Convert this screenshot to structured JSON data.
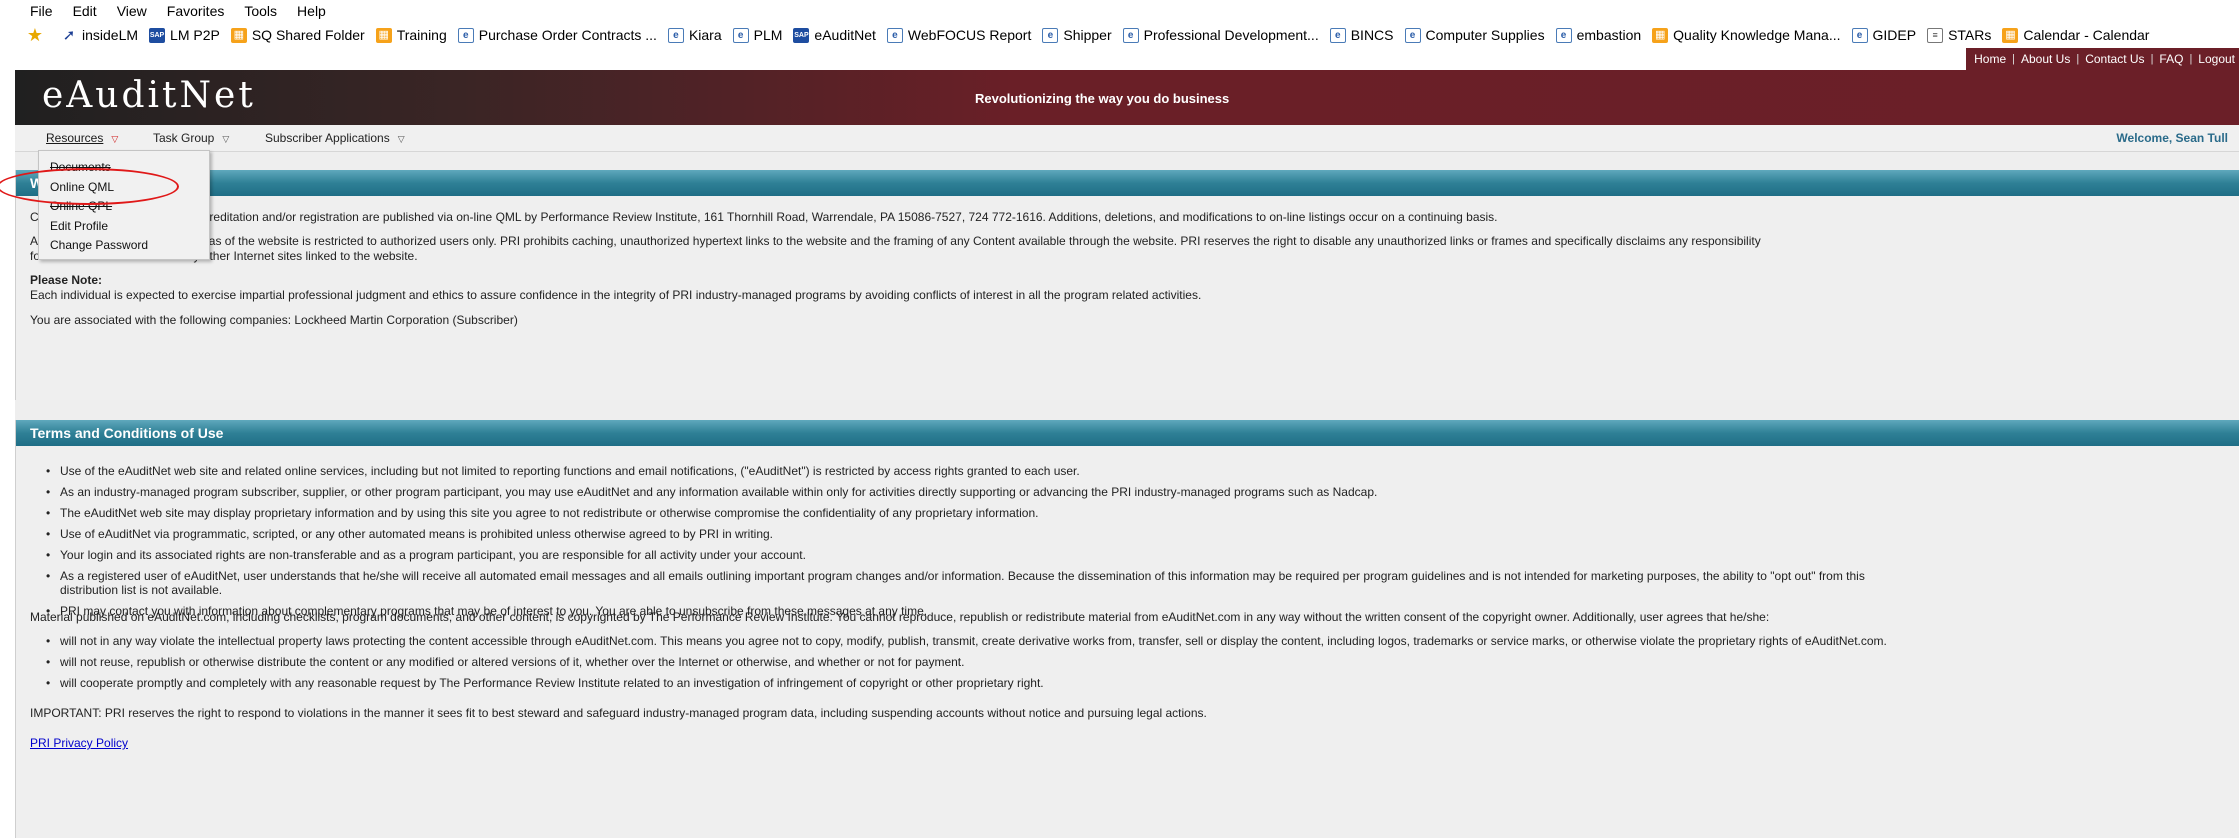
{
  "browser": {
    "menu": [
      "File",
      "Edit",
      "View",
      "Favorites",
      "Tools",
      "Help"
    ],
    "favorites": [
      {
        "label": "insideLM",
        "icon": "arrow-icon"
      },
      {
        "label": "LM P2P",
        "icon": "sap-icon"
      },
      {
        "label": "SQ Shared Folder",
        "icon": "orange-page-icon"
      },
      {
        "label": "Training",
        "icon": "orange-page-icon"
      },
      {
        "label": "Purchase Order Contracts ...",
        "icon": "ie-icon"
      },
      {
        "label": "Kiara",
        "icon": "ie-icon"
      },
      {
        "label": "PLM",
        "icon": "ie-icon"
      },
      {
        "label": "eAuditNet",
        "icon": "sap-icon"
      },
      {
        "label": "WebFOCUS Report",
        "icon": "ie-icon"
      },
      {
        "label": "Shipper",
        "icon": "ie-icon"
      },
      {
        "label": "Professional Development...",
        "icon": "ie-icon"
      },
      {
        "label": "BINCS",
        "icon": "ie-icon"
      },
      {
        "label": "Computer Supplies",
        "icon": "ie-icon"
      },
      {
        "label": "embastion",
        "icon": "ie-icon"
      },
      {
        "label": "Quality Knowledge Mana...",
        "icon": "orange-page-icon"
      },
      {
        "label": "GIDEP",
        "icon": "ie-icon"
      },
      {
        "label": "STARs",
        "icon": "page-icon"
      },
      {
        "label": "Calendar - Calendar",
        "icon": "orange-page-icon"
      }
    ]
  },
  "header": {
    "logo": "eAuditNet",
    "tagline": "Revolutionizing the way you do business",
    "links": [
      "Home",
      "About Us",
      "Contact Us",
      "FAQ",
      "Logout"
    ]
  },
  "nav": {
    "resources": "Resources",
    "task_group": "Task Group",
    "subscriber_apps": "Subscriber Applications",
    "welcome": "Welcome, Sean Tull"
  },
  "dropdown": {
    "items": [
      "Documents",
      "Online QML",
      "Online QPL",
      "Edit Profile",
      "Change Password"
    ]
  },
  "welcome_panel": {
    "title": "W",
    "line1": "C                                ance Review Institute (PRI) accreditation and/or registration are published via on-line QML by Performance Review Institute, 161 Thornhill Road, Warrendale, PA 15086-7527, 724 772-1616. Additions, deletions, and modifications to on-line listings occur on a continuing basis.",
    "line2a": "A                                 ord protected and/or secure areas of the website is restricted to authorized users only. PRI prohibits caching, unauthorized hypertext links to the website and the framing of any Content available through the website. PRI reserves the right to disable any unauthorized links or frames and specifically disclaims any responsibility",
    "line2b": "for the Content available on any other Internet sites linked to the website.",
    "note_heading": "Please Note:",
    "note_text": "Each individual is expected to exercise impartial professional judgment and ethics to assure confidence in the integrity of PRI industry-managed programs by avoiding conflicts of interest in all the program related activities.",
    "association": "You are associated with the following companies: Lockheed Martin Corporation (Subscriber)"
  },
  "terms_panel": {
    "title": "Terms and Conditions of Use",
    "bullets": [
      "Use of the eAuditNet web site and related online services, including but not limited to reporting functions and email notifications, (\"eAuditNet\") is restricted by access rights granted to each user.",
      "As an industry-managed program subscriber, supplier, or other program participant, you may use eAuditNet and any information available within only for activities directly supporting or advancing the PRI industry-managed programs such as Nadcap.",
      "The eAuditNet web site may display proprietary information and by using this site you agree to not redistribute or otherwise compromise the confidentiality of any proprietary information.",
      "Use of eAuditNet via programmatic, scripted, or any other automated means is prohibited unless otherwise agreed to by PRI in writing.",
      "Your login and its associated rights are non-transferable and as a program participant, you are responsible for all activity under your account.",
      "As a registered user of eAuditNet, user understands that he/she will receive all automated email messages and all emails outlining important program changes and/or information. Because the dissemination of this information may be required per program guidelines and is not intended for marketing purposes, the ability to \"opt out\" from this",
      "PRI may contact you with information about complementary programs that may be of interest to you. You are able to unsubscribe from these messages at any time."
    ],
    "bullet6_cont": "distribution list is not available.",
    "material": "Material published on eAuditNet.com, including checklists, program documents, and other content, is copyrighted by The Performance Review Institute. You cannot reproduce, republish or redistribute material from eAuditNet.com in any way without the written consent of the copyright owner. Additionally, user agrees that he/she:",
    "bullets2": [
      "will not in any way violate the intellectual property laws protecting the content accessible through eAuditNet.com. This means you agree not to copy, modify, publish, transmit, create derivative works from, transfer, sell or display the content, including logos, trademarks or service marks, or otherwise violate the proprietary rights of eAuditNet.com.",
      "will not reuse, republish or otherwise distribute the content or any modified or altered versions of it, whether over the Internet or otherwise, and whether or not for payment.",
      "will cooperate promptly and completely with any reasonable request by The Performance Review Institute related to an investigation of infringement of copyright or other proprietary right."
    ],
    "important": "IMPORTANT: PRI reserves the right to respond to violations in the manner it sees fit to best steward and safeguard industry-managed program data, including suspending accounts without notice and pursuing legal actions.",
    "privacy": "PRI Privacy Policy"
  }
}
